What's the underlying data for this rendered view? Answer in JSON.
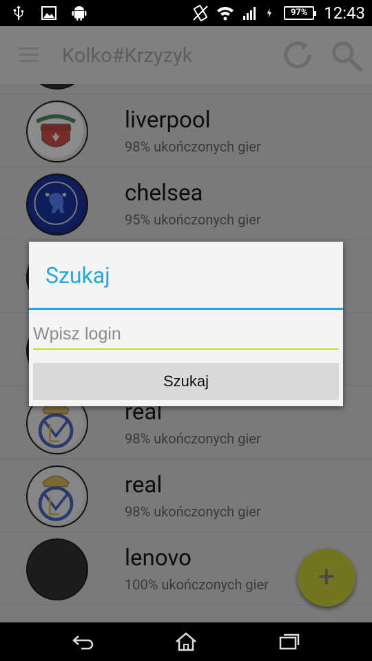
{
  "status_bar": {
    "left_icons": [
      "usb-icon",
      "image-icon",
      "android-icon"
    ],
    "right_icons": [
      "vibrate-icon",
      "wifi-icon",
      "signal-icon",
      "charging-icon"
    ],
    "battery": "97%",
    "time": "12:43"
  },
  "app_bar": {
    "title": "Kolko#Krzyzyk",
    "menu_icon": "hamburger-menu-icon",
    "refresh_icon": "refresh-icon",
    "search_icon": "search-icon"
  },
  "list": {
    "items": [
      {
        "name": "",
        "stat": "",
        "avatar": "dark"
      },
      {
        "name": "liverpool",
        "stat": "98% ukończonych gier",
        "avatar": "liverpool-crest"
      },
      {
        "name": "chelsea",
        "stat": "95% ukończonych gier",
        "avatar": "chelsea-crest"
      },
      {
        "name": "",
        "stat": "",
        "avatar": "dark"
      },
      {
        "name": "",
        "stat": "",
        "avatar": "dark"
      },
      {
        "name": "real",
        "stat": "98% ukończonych gier",
        "avatar": "real-madrid-crest"
      },
      {
        "name": "real",
        "stat": "98% ukończonych gier",
        "avatar": "real-madrid-crest"
      },
      {
        "name": "lenovo",
        "stat": "100% ukończonych gier",
        "avatar": "dark"
      }
    ]
  },
  "fab": {
    "label": "+"
  },
  "dialog": {
    "title": "Szukaj",
    "input_value": "",
    "input_placeholder": "Wpisz login",
    "button_label": "Szukaj",
    "accent_color": "#29a7d8",
    "input_underline_color": "#c9dc1c"
  },
  "nav_bar": {
    "buttons": [
      "back-icon",
      "home-icon",
      "recents-icon"
    ]
  }
}
